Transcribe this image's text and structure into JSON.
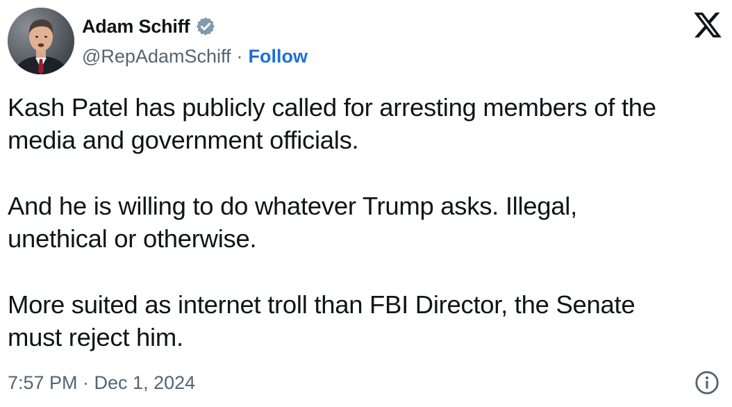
{
  "author": {
    "name": "Adam Schiff",
    "handle": "@RepAdamSchiff",
    "separator": "·",
    "follow_label": "Follow",
    "verified_icon": "verified-badge-icon",
    "avatar_icon": "profile-photo"
  },
  "tweet": {
    "paragraphs": [
      "Kash Patel has publicly called for arresting members of the\nmedia and government officials.",
      "And he is willing to do whatever Trump asks. Illegal,\nunethical or otherwise.",
      "More suited as internet troll than FBI Director, the Senate\nmust reject him."
    ]
  },
  "footer": {
    "timestamp": "7:57 PM · Dec 1, 2024",
    "info_icon": "info-icon"
  },
  "branding": {
    "logo_icon": "x-logo-icon"
  },
  "colors": {
    "text": "#0f1419",
    "secondary": "#536471",
    "follow": "#1d6fd8",
    "badge": "#829aab"
  }
}
